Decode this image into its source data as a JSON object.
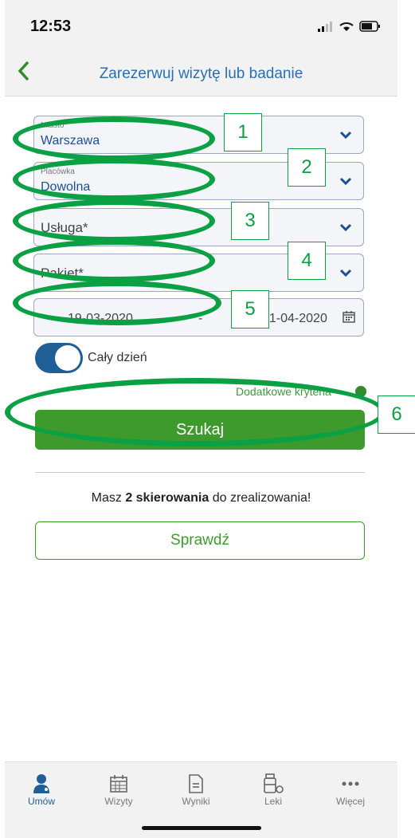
{
  "status_bar": {
    "time": "12:53"
  },
  "header": {
    "title": "Zarezerwuj wizytę lub badanie",
    "back_icon": "chevron-left-icon"
  },
  "form": {
    "city": {
      "label": "Miasto*",
      "value": "Warszawa"
    },
    "facility": {
      "label": "Placówka",
      "value": "Dowolna"
    },
    "service": {
      "placeholder": "Usługa*"
    },
    "package": {
      "placeholder": "Pakiet*"
    },
    "date_range": {
      "from": "19-03-2020",
      "separator": "-",
      "to": "31-04-2020"
    },
    "all_day": {
      "label": "Cały dzień",
      "on": true
    },
    "extra_criteria": "Dodatkowe kryteria",
    "search_button": "Szukaj"
  },
  "referrals": {
    "prefix": "Masz ",
    "count_text": "2 skierowania",
    "suffix": " do zrealizowania!",
    "check_button": "Sprawdź"
  },
  "tabs": [
    {
      "label": "Umów",
      "icon": "doctor-icon",
      "active": true
    },
    {
      "label": "Wizyty",
      "icon": "calendar-icon"
    },
    {
      "label": "Wyniki",
      "icon": "document-icon"
    },
    {
      "label": "Leki",
      "icon": "pills-icon"
    },
    {
      "label": "Więcej",
      "icon": "more-icon"
    }
  ],
  "annotations": [
    "1",
    "2",
    "3",
    "4",
    "5",
    "6"
  ],
  "colors": {
    "accent_green": "#3f9a2e",
    "title_blue": "#2a6fb4",
    "annotation_green": "#0aa043"
  }
}
